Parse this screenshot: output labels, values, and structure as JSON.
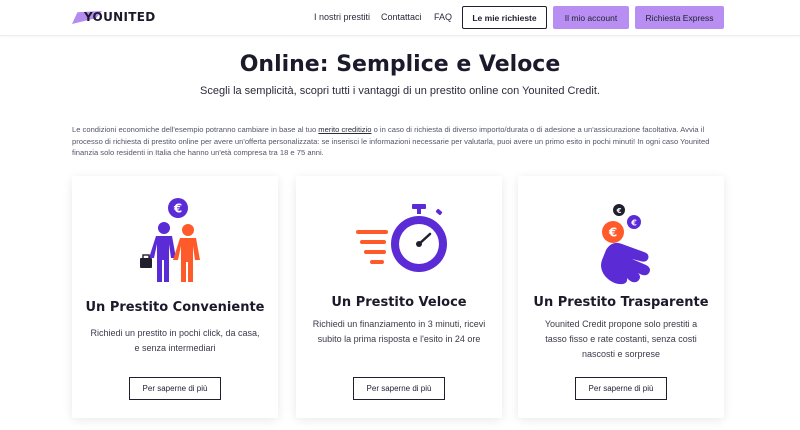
{
  "brand": {
    "name": "YOUNITED",
    "accent": "#b88ef2",
    "orange": "#ff5a2a",
    "purple": "#5b2bd6"
  },
  "nav": {
    "links": [
      "I nostri prestiti",
      "Contattaci",
      "FAQ"
    ],
    "my_requests": "Le mie richieste",
    "my_account": "Il mio account",
    "express": "Richiesta Express"
  },
  "hero": {
    "title": "Online: Semplice e Veloce",
    "subtitle": "Scegli la semplicità, scopri tutti i vantaggi di un prestito online con Younited Credit."
  },
  "disclaimer": {
    "part1": "Le condizioni economiche dell'esempio potranno cambiare in base al tuo ",
    "link": "merito creditizio",
    "part2": " o in caso di richiesta di diverso importo/durata o di adesione a un'assicurazione facoltativa. Avvia il processo di richiesta di prestito online per avere un'offerta personalizzata: se inserisci le informazioni necessarie per valutarla, puoi avere un primo esito in pochi minuti! In ogni caso Younited finanzia solo residenti in Italia che hanno un'età compresa tra 18 e 75 anni."
  },
  "cards": [
    {
      "icon": "people-euro-icon",
      "title": "Un Prestito Conveniente",
      "description": "Richiedi un prestito in pochi click, da casa, e senza intermediari",
      "button": "Per saperne di più"
    },
    {
      "icon": "stopwatch-icon",
      "title": "Un Prestito Veloce",
      "description": "Richiedi un finanziamento in 3 minuti, ricevi subito la prima risposta e l'esito in 24 ore",
      "button": "Per saperne di più"
    },
    {
      "icon": "hand-coins-icon",
      "title": "Un Prestito Trasparente",
      "description": "Younited Credit propone solo prestiti a tasso fisso e rate costanti, senza costi nascosti e sorprese",
      "button": "Per saperne di più"
    }
  ]
}
